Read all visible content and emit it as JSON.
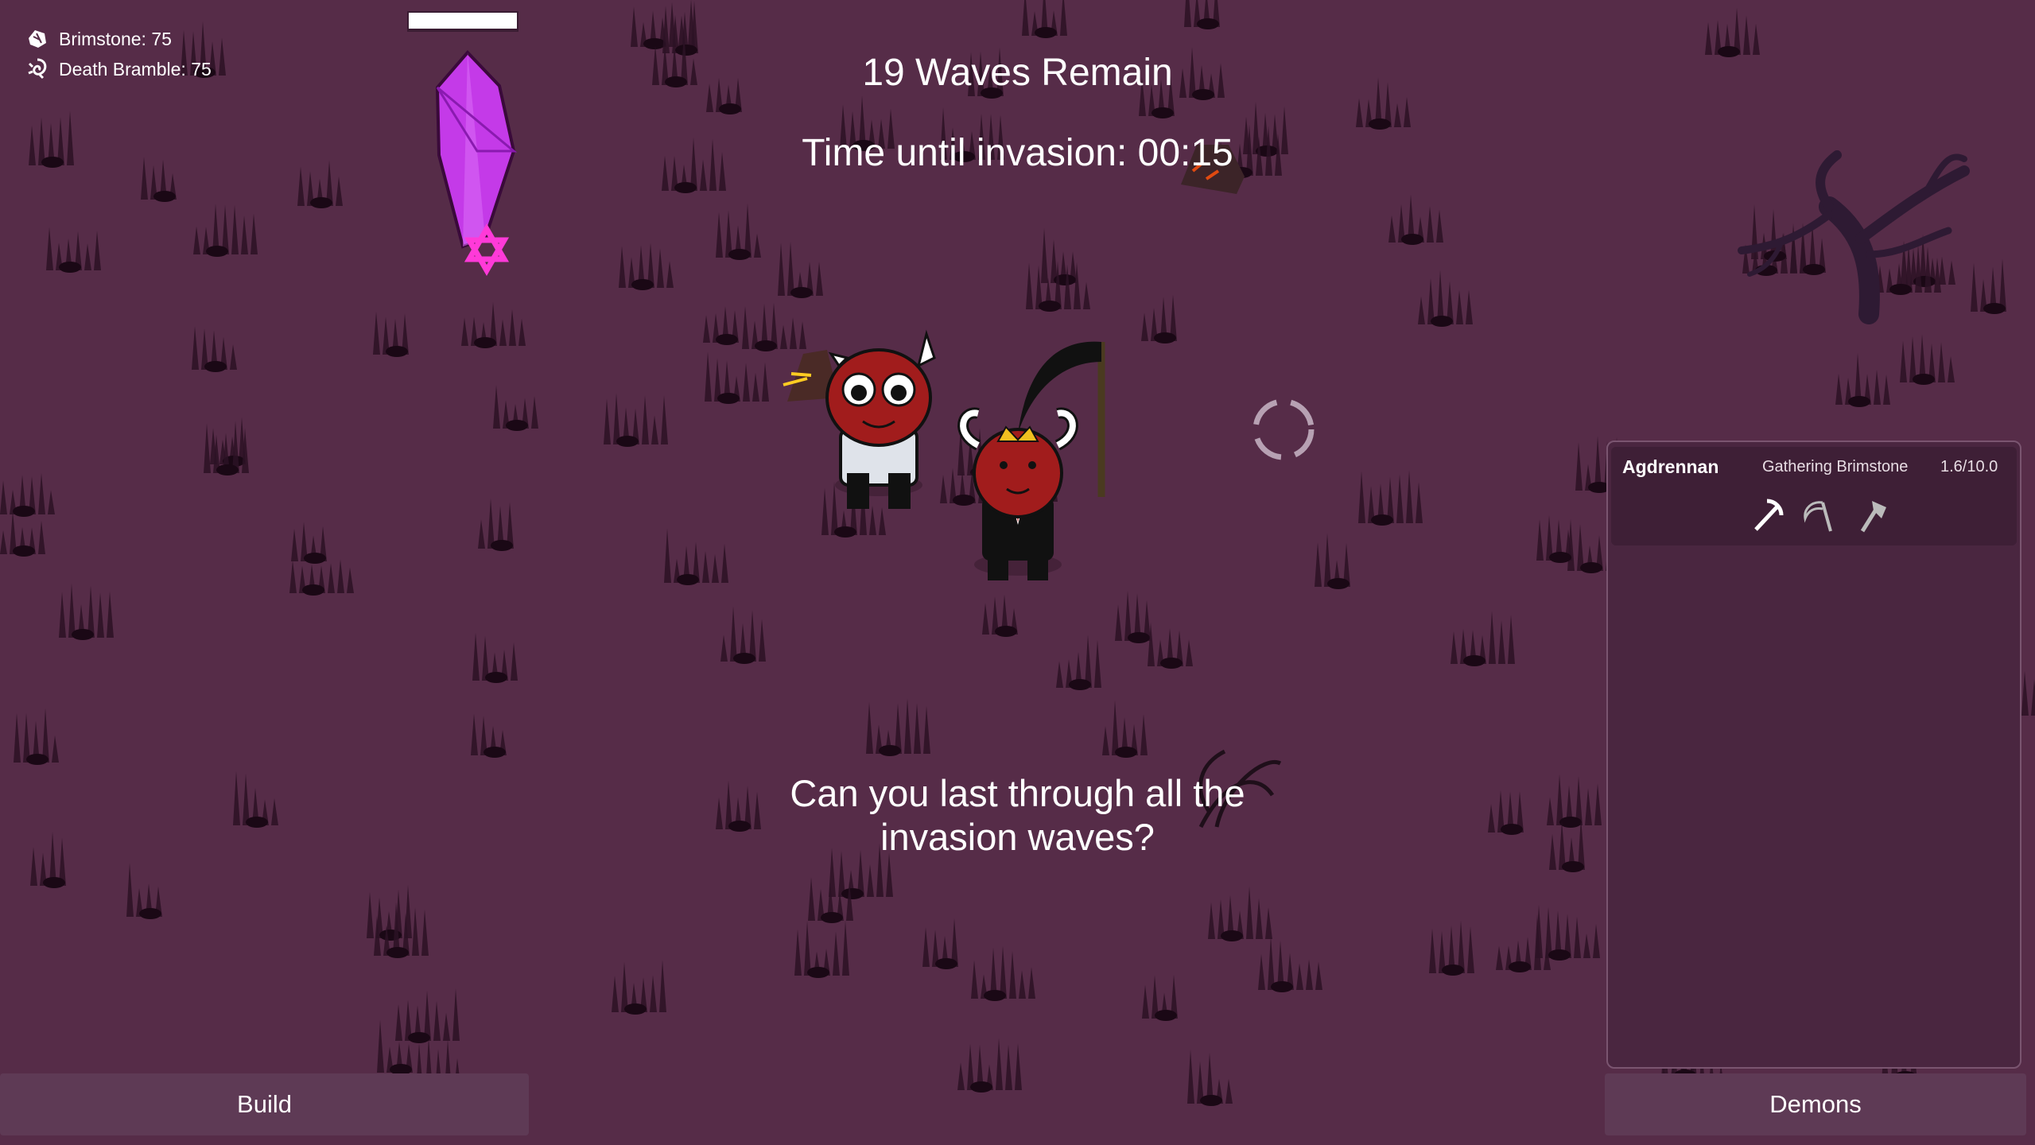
{
  "resources": [
    {
      "label": "Brimstone: 75",
      "icon": "brimstone-icon"
    },
    {
      "label": "Death Bramble: 75",
      "icon": "death-bramble-icon"
    }
  ],
  "waves_remaining": "19 Waves Remain",
  "timer": "Time until invasion: 00:15",
  "tagline_line1": "Can you last through all the",
  "tagline_line2": "invasion waves?",
  "demon_panel": {
    "demon_name": "Agdrennan",
    "task": "Gathering Brimstone",
    "progress": "1.6/10.0",
    "tools": [
      "pickaxe-icon",
      "scythe-icon",
      "axe-icon"
    ]
  },
  "buttons": {
    "build": "Build",
    "demons": "Demons"
  },
  "colors": {
    "ground": "#562c48",
    "crystal": "#c43ae8",
    "demon": "#a11c1c"
  }
}
